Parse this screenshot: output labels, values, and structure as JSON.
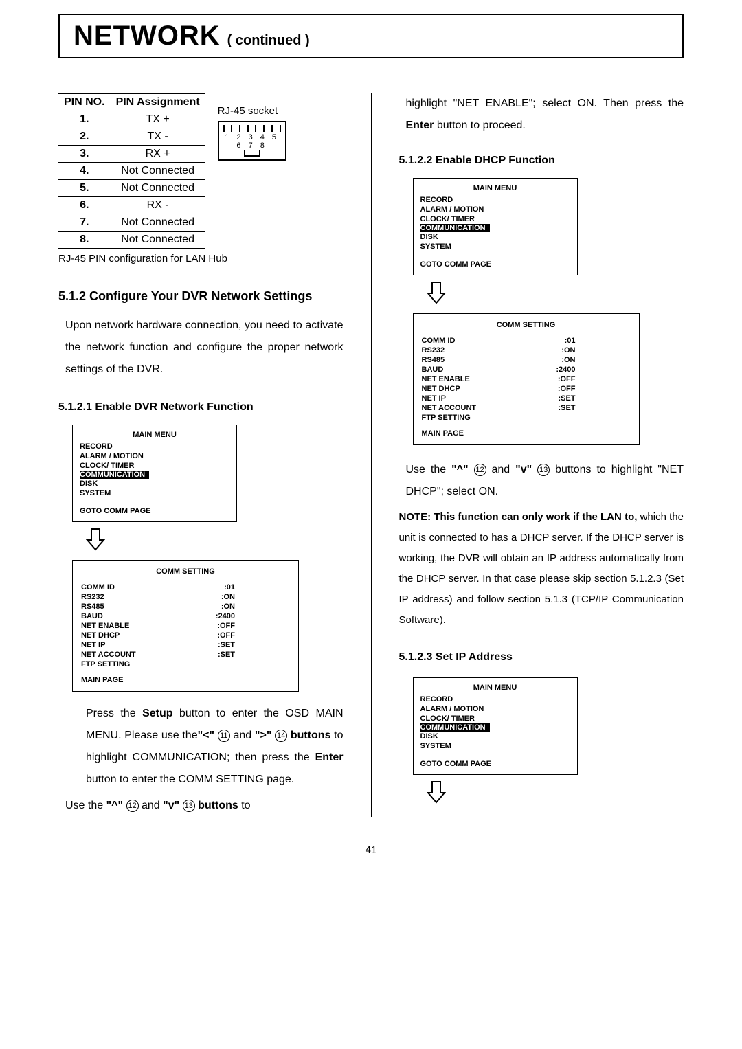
{
  "header": {
    "main": "NETWORK",
    "sub": "( continued )"
  },
  "left": {
    "pin_header_no": "PIN NO.",
    "pin_header_assign": "PIN Assignment",
    "pins": [
      {
        "no": "1.",
        "assign": "TX +"
      },
      {
        "no": "2.",
        "assign": "TX -"
      },
      {
        "no": "3.",
        "assign": "RX +"
      },
      {
        "no": "4.",
        "assign": "Not Connected"
      },
      {
        "no": "5.",
        "assign": "Not Connected"
      },
      {
        "no": "6.",
        "assign": "RX -"
      },
      {
        "no": "7.",
        "assign": "Not Connected"
      },
      {
        "no": "8.",
        "assign": "Not Connected"
      }
    ],
    "rj45_label": "RJ-45 socket",
    "rj45_nums": "1 2 3 4 5 6 7 8",
    "pin_caption": "RJ-45 PIN configuration for LAN Hub",
    "h_5_1_2": "5.1.2 Configure Your DVR Network Settings",
    "p_5_1_2": "Upon network hardware connection, you need to activate the network function and configure the proper network settings of the DVR.",
    "h_5_1_2_1": "5.1.2.1 Enable DVR Network Function",
    "menu1": {
      "title": "MAIN  MENU",
      "items": [
        "RECORD",
        "ALARM / MOTION",
        "CLOCK/ TIMER",
        "COMMUNICATION",
        "DISK",
        "SYSTEM"
      ],
      "highlighted": "COMMUNICATION",
      "goto": "GOTO COMM PAGE"
    },
    "comm1": {
      "title": "COMM SETTING",
      "rows": [
        {
          "k": "COMM ID",
          "v": ":01"
        },
        {
          "k": "RS232",
          "v": ":ON"
        },
        {
          "k": "RS485",
          "v": ":ON"
        },
        {
          "k": "BAUD",
          "v": ":2400"
        },
        {
          "k": "NET ENABLE",
          "v": ":OFF"
        },
        {
          "k": "NET DHCP",
          "v": ":OFF"
        },
        {
          "k": "NET IP",
          "v": ":SET"
        },
        {
          "k": "NET ACCOUNT",
          "v": ":SET"
        },
        {
          "k": "FTP SETTING",
          "v": ""
        }
      ],
      "main": "MAIN PAGE"
    },
    "p_press_pre": "Press the ",
    "p_press_setup": "Setup",
    "p_press_mid1": " button to enter the OSD MAIN MENU. Please use the",
    "p_press_lt": "\"<\"",
    "ref_11": "11",
    "p_press_and": " and  ",
    "p_press_gt": "\">\"",
    "ref_14": "14",
    "p_press_btns": " buttons",
    "p_press_mid2": " to highlight COMMUNICATION; then press the ",
    "p_press_enter": "Enter",
    "p_press_end": " button to enter the COMM SETTING page.",
    "p_use_pre": "Use the ",
    "p_use_up": "\"^\"",
    "ref_12": "12",
    "p_use_and": " and ",
    "p_use_dn": "\"v\"",
    "ref_13": "13",
    "p_use_btns": " buttons",
    "p_use_to": " to"
  },
  "right": {
    "p_cont1": "highlight \"NET ENABLE\"; select ON. Then press the ",
    "p_cont_enter": "Enter",
    "p_cont2": " button to proceed.",
    "h_5_1_2_2": "5.1.2.2 Enable DHCP Function",
    "menu2": {
      "title": "MAIN  MENU",
      "items": [
        "RECORD",
        "ALARM / MOTION",
        "CLOCK/ TIMER",
        "COMMUNICATION",
        "DISK",
        "SYSTEM"
      ],
      "highlighted": "COMMUNICATION",
      "goto": "GOTO COMM PAGE"
    },
    "comm2": {
      "title": "COMM SETTING",
      "rows": [
        {
          "k": "COMM ID",
          "v": ":01"
        },
        {
          "k": "RS232",
          "v": ":ON"
        },
        {
          "k": "RS485",
          "v": ":ON"
        },
        {
          "k": "BAUD",
          "v": ":2400"
        },
        {
          "k": "NET ENABLE",
          "v": ":OFF"
        },
        {
          "k": "NET DHCP",
          "v": ":OFF"
        },
        {
          "k": "NET IP",
          "v": ":SET"
        },
        {
          "k": "NET ACCOUNT",
          "v": ":SET"
        },
        {
          "k": "FTP SETTING",
          "v": ""
        }
      ],
      "main": "MAIN PAGE"
    },
    "p_use2_pre": "Use the ",
    "p_use2_up": "\"^\"",
    "p_use2_and": " and ",
    "p_use2_dn": "\"v\"",
    "p_use2_end": " buttons to highlight \"NET DHCP\"; select ON.",
    "note_pre": "NOTE: This function can only work if the LAN to,",
    "note_body": " which the unit is connected to has a DHCP server. If the DHCP server is working, the DVR will obtain an IP address automatically from the DHCP server. In that case please skip section 5.1.2.3 (Set IP address) and follow section 5.1.3 (TCP/IP Communication Software).",
    "h_5_1_2_3": "5.1.2.3 Set IP Address",
    "menu3": {
      "title": "MAIN  MENU",
      "items": [
        "RECORD",
        "ALARM / MOTION",
        "CLOCK/ TIMER",
        "COMMUNICATION",
        "DISK",
        "SYSTEM"
      ],
      "highlighted": "COMMUNICATION",
      "goto": "GOTO COMM PAGE"
    }
  },
  "page_number": "41"
}
